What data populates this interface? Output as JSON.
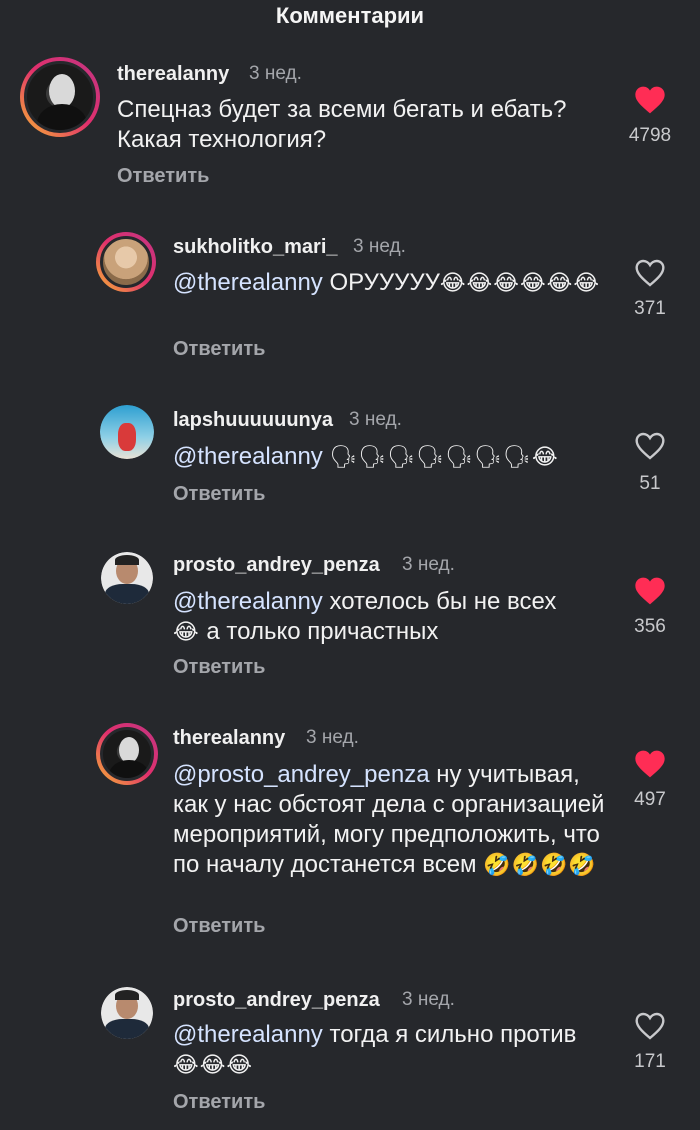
{
  "header": {
    "title": "Комментарии"
  },
  "reply_label": "Ответить",
  "colors": {
    "liked": "#ff2d55",
    "background": "#26282c",
    "mention": "#d5e3ff"
  },
  "comments": [
    {
      "username": "therealanny",
      "time": "3 нед.",
      "mention": "",
      "text": "Спецназ будет за всеми бегать и ебать? Какая технология?",
      "emoji": "",
      "liked": true,
      "likes": "4798"
    },
    {
      "username": "sukholitko_mari_",
      "time": "3 нед.",
      "mention": "@therealanny",
      "text": " ОРУУУУУ",
      "emoji": "😂😂😂😂😂😂",
      "liked": false,
      "likes": "371"
    },
    {
      "username": "lapshuuuuuunya",
      "time": "3 нед.",
      "mention": "@therealanny",
      "text": " ",
      "emoji": "🗣🗣🗣🗣🗣🗣🗣😂",
      "liked": false,
      "likes": "51"
    },
    {
      "username": "prosto_andrey_penza",
      "time": "3 нед.",
      "mention": "@therealanny",
      "text": "  хотелось бы не всех",
      "emoji2": "😂",
      "text2": " а только причастных",
      "liked": true,
      "likes": "356"
    },
    {
      "username": "therealanny",
      "time": "3 нед.",
      "mention": "@prosto_andrey_penza",
      "text": " ну учитывая, как у нас обстоят дела с организацией мероприятий, могу предположить, что по началу достанется всем ",
      "emoji": "🤣🤣🤣🤣",
      "liked": true,
      "likes": "497"
    },
    {
      "username": "prosto_andrey_penza",
      "time": "3 нед.",
      "mention": "@therealanny",
      "text": " тогда я сильно против",
      "emoji": "😂😂😂",
      "liked": false,
      "likes": "171"
    }
  ]
}
